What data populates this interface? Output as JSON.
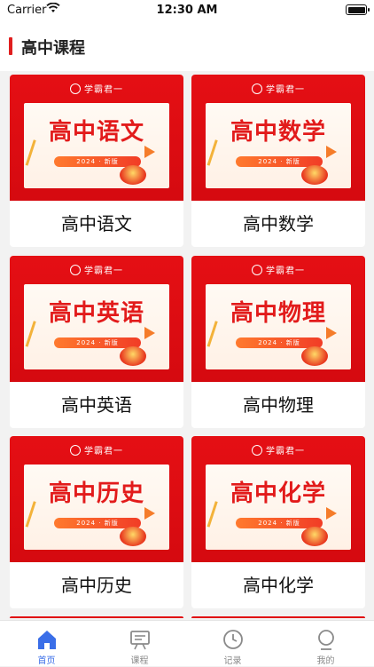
{
  "status_bar": {
    "carrier": "Carrier",
    "time": "12:30 AM"
  },
  "header": {
    "title": "高中课程"
  },
  "courses": [
    {
      "title": "高中语文",
      "brand": "学霸君一",
      "tag": "2024 · 新版"
    },
    {
      "title": "高中数学",
      "brand": "学霸君一",
      "tag": "2024 · 新版"
    },
    {
      "title": "高中英语",
      "brand": "学霸君一",
      "tag": "2024 · 新版"
    },
    {
      "title": "高中物理",
      "brand": "学霸君一",
      "tag": "2024 · 新版"
    },
    {
      "title": "高中历史",
      "brand": "学霸君一",
      "tag": "2024 · 新版"
    },
    {
      "title": "高中化学",
      "brand": "学霸君一",
      "tag": "2024 · 新版"
    }
  ],
  "tabs": [
    {
      "label": "首页",
      "icon": "home-icon",
      "active": true
    },
    {
      "label": "课程",
      "icon": "board-icon",
      "active": false
    },
    {
      "label": "记录",
      "icon": "clock-icon",
      "active": false
    },
    {
      "label": "我的",
      "icon": "person-icon",
      "active": false
    }
  ],
  "colors": {
    "accent": "#e01e1e",
    "active_tab": "#3a6ee8",
    "inactive_tab": "#8a8a8a"
  }
}
